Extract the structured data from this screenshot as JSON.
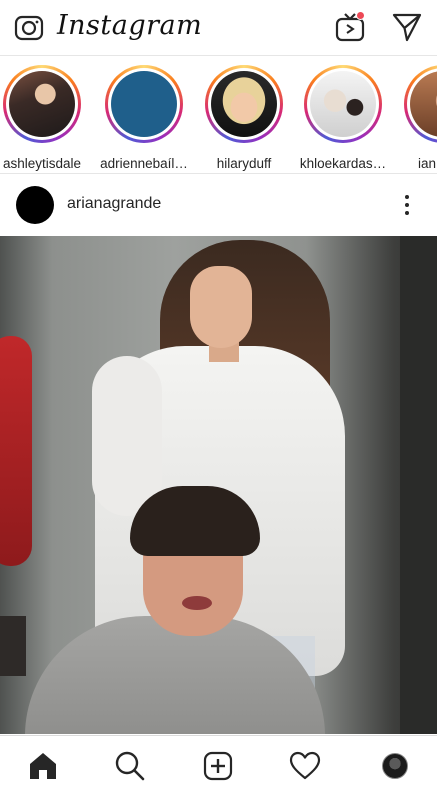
{
  "header": {
    "logo": "Instagram",
    "icons": [
      "camera-icon",
      "igtv-icon",
      "direct-message-icon"
    ],
    "igtv_notification": true,
    "notification_color": "#ed4956"
  },
  "stories": [
    {
      "username": "ashleytisdale"
    },
    {
      "username": "adriennebaíl…"
    },
    {
      "username": "hilaryduff"
    },
    {
      "username": "khloekardas…"
    },
    {
      "username": "ian"
    }
  ],
  "post": {
    "username": "arianagrande",
    "menu_icon": "more-vertical-icon"
  },
  "bottom_nav": {
    "items": [
      "home-icon",
      "search-icon",
      "add-post-icon",
      "activity-heart-icon",
      "profile-avatar"
    ],
    "active": "home-icon"
  },
  "colors": {
    "text": "#262626",
    "divider": "#e6e6e6",
    "story_ring": [
      "#feda75",
      "#fa7e1e",
      "#d62976",
      "#962fbf",
      "#4f5bd5"
    ]
  }
}
